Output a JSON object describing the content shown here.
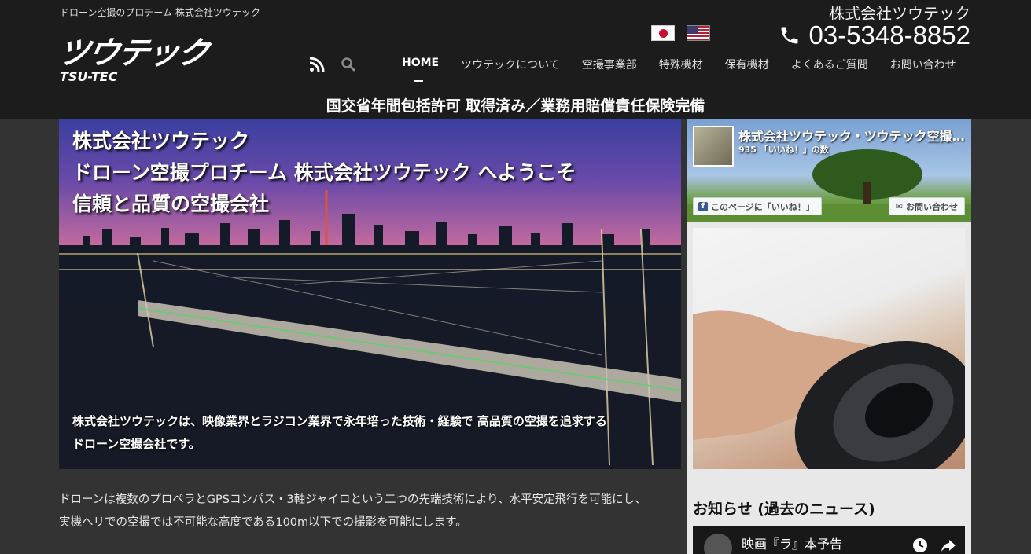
{
  "header": {
    "tagline": "ドローン空撮のプロチーム 株式会社ツウテック",
    "logo_jp": "ツウテック",
    "logo_en": "TSU-TEC",
    "company": "株式会社ツウテック",
    "phone": "03-5348-8852",
    "banner": "国交省年間包括許可 取得済み／業務用賠償責任保険完備"
  },
  "nav": {
    "items": [
      {
        "label": "HOME"
      },
      {
        "label": "ツウテックについて"
      },
      {
        "label": "空撮事業部"
      },
      {
        "label": "特殊機材"
      },
      {
        "label": "保有機材"
      },
      {
        "label": "よくあるご質問"
      },
      {
        "label": "お問い合わせ"
      }
    ]
  },
  "hero": {
    "title_lines": [
      "株式会社ツウテック",
      "ドローン空撮プロチーム 株式会社ツウテック へようこそ",
      "信頼と品質の空撮会社"
    ],
    "caption": "株式会社ツウテックは、映像業界とラジコン業界で永年培った技術・経験で 高品質の空撮を追求するドローン空撮会社です。"
  },
  "facebook": {
    "page_name": "株式会社ツウテック・ツウテック空撮事業部",
    "likes": "935 「いいね！」の数",
    "like_button": "このページに「いいね！」",
    "contact_button": "お問い合わせ"
  },
  "news": {
    "heading": "お知らせ",
    "open_paren": " (",
    "link": "過去のニュース",
    "close_paren": ")",
    "video_title": "映画『ラ』本予告"
  },
  "main": {
    "paragraphs": [
      "ドローンは複数のプロペラとGPSコンパス・3軸ジャイロという二つの先端技術により、水平安定飛行を可能にし、実機ヘリでの空撮では不可能な高度である100m以下での撮影を可能にします。"
    ]
  },
  "colors": {
    "header_bg": "#1c1c1c",
    "page_bg": "#333333",
    "sidebar_bg": "#e8e8e8"
  }
}
